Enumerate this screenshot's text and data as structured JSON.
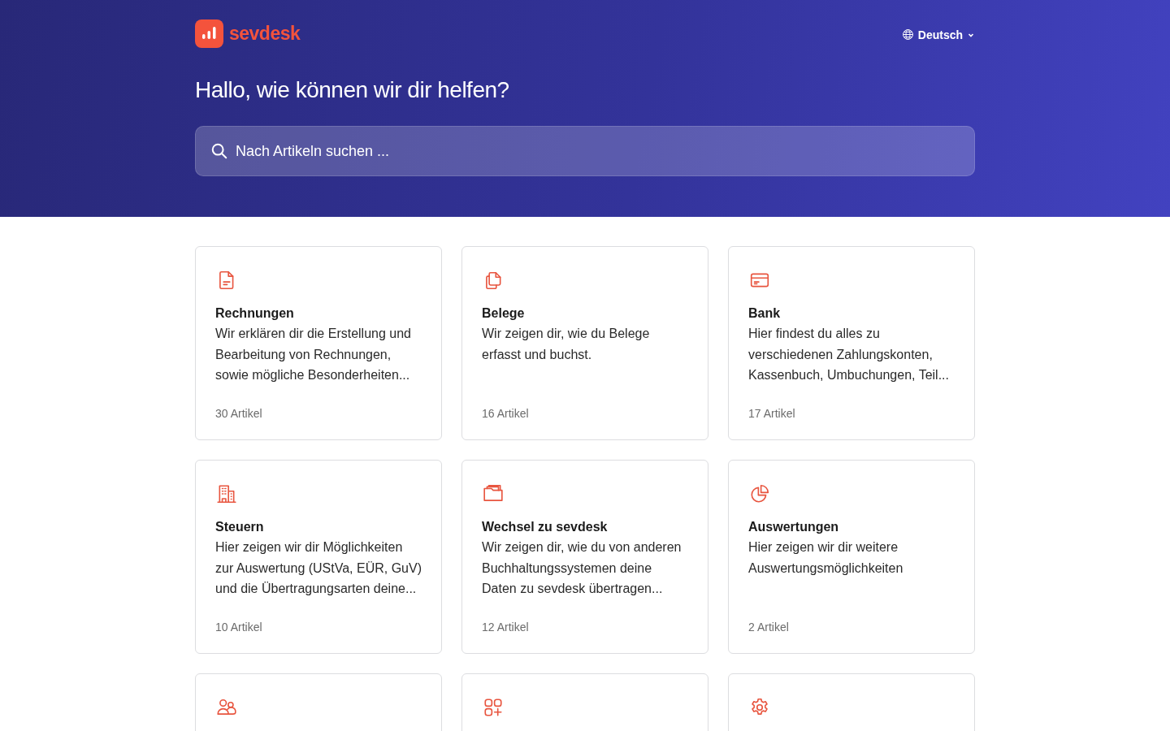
{
  "header": {
    "logo_text": "sevdesk",
    "language": "Deutsch",
    "heading": "Hallo, wie können wir dir helfen?",
    "search": {
      "placeholder": "Nach Artikeln suchen ..."
    }
  },
  "collections": [
    {
      "kind": "full",
      "title": "Rechnungen",
      "description": "Wir erklären dir die Erstellung und Bearbeitung von Rechnungen, sowie mögliche Besonderheiten...",
      "count": "30 Artikel"
    },
    {
      "kind": "full",
      "title": "Belege",
      "description": "Wir zeigen dir, wie du Belege erfasst und buchst.",
      "count": "16 Artikel"
    },
    {
      "kind": "full",
      "title": "Bank",
      "description": "Hier findest du alles zu verschiedenen Zahlungskonten, Kassenbuch, Umbuchungen, Teil...",
      "count": "17 Artikel"
    },
    {
      "kind": "full",
      "title": "Steuern",
      "description": "Hier zeigen wir dir Möglichkeiten zur Auswertung (UStVa, EÜR, GuV) und die Übertragungsarten deine...",
      "count": "10 Artikel"
    },
    {
      "kind": "full",
      "title": "Wechsel zu sevdesk",
      "description": "Wir zeigen dir, wie du von anderen Buchhaltungssystemen deine Daten zu sevdesk übertragen...",
      "count": "12 Artikel"
    },
    {
      "kind": "full",
      "title": "Auswertungen",
      "description": "Hier zeigen wir dir weitere Auswertungsmöglichkeiten",
      "count": "2 Artikel"
    },
    {
      "kind": "cut_off"
    },
    {
      "kind": "cut_off"
    },
    {
      "kind": "cut_off"
    }
  ]
}
